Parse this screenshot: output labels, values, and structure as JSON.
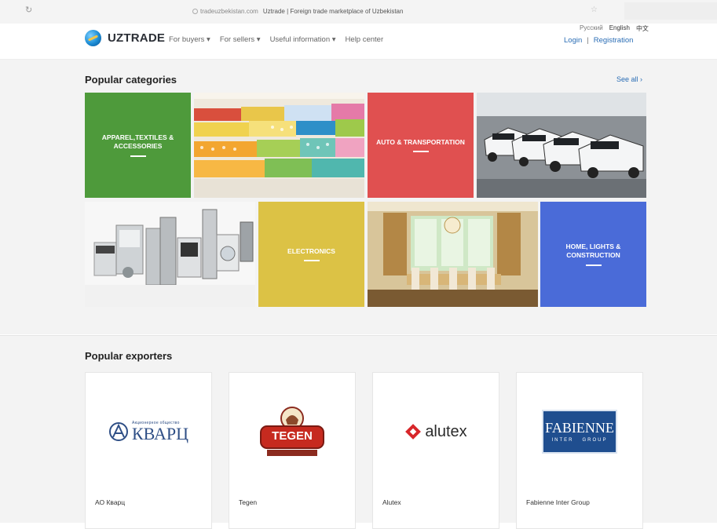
{
  "browser": {
    "domain": "tradeuzbekistan.com",
    "page_title": "Uztrade | Foreign trade marketplace of Uzbekistan"
  },
  "header": {
    "logo_text": "UZTRADE",
    "nav": [
      "For buyers ▾",
      "For sellers ▾",
      "Useful information ▾",
      "Help center"
    ],
    "languages": [
      "Русский",
      "English",
      "中文"
    ],
    "login": "Login",
    "separator": "|",
    "register": "Registration"
  },
  "categories": {
    "title": "Popular categories",
    "see_all": "See all  ›",
    "items": [
      {
        "label": "APPAREL,TEXTILES & ACCESSORIES",
        "color": "#4e9a3b"
      },
      {
        "label": "AUTO & TRANSPORTATION",
        "color": "#e05050"
      },
      {
        "label": "ELECTRONICS",
        "color": "#dcc245"
      },
      {
        "label": "HOME, LIGHTS & CONSTRUCTION",
        "color": "#4a6bd8"
      }
    ]
  },
  "exporters": {
    "title": "Popular exporters",
    "items": [
      {
        "name": "АО Кварц",
        "logo_text": "КВАРЦ",
        "logo_subtext": "Акционерное общество"
      },
      {
        "name": "Tegen",
        "logo_text": "TEGEN"
      },
      {
        "name": "Alutex",
        "logo_text": "alutex"
      },
      {
        "name": "Fabienne Inter Group",
        "logo_text": "FABIENNE",
        "logo_subtext": "INTER   GROUP"
      }
    ]
  }
}
